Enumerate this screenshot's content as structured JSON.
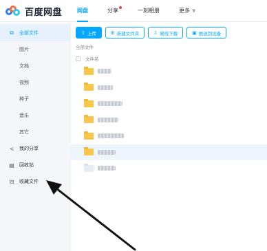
{
  "app": {
    "logo_text": "百度网盘"
  },
  "nav": [
    {
      "label": "网盘",
      "active": true
    },
    {
      "label": "分享",
      "dot": true
    },
    {
      "label": "一刻相册"
    },
    {
      "label": "更多"
    }
  ],
  "sidebar": {
    "items": [
      {
        "label": "全部文件",
        "icon": "files-icon",
        "active": true
      },
      {
        "label": "图片",
        "sub": true
      },
      {
        "label": "文档",
        "sub": true
      },
      {
        "label": "视频",
        "sub": true
      },
      {
        "label": "种子",
        "sub": true
      },
      {
        "label": "音乐",
        "sub": true
      },
      {
        "label": "其它",
        "sub": true
      },
      {
        "label": "我的分享",
        "icon": "share-icon"
      },
      {
        "label": "回收站",
        "icon": "recycle-bin-icon"
      },
      {
        "label": "收藏文件",
        "icon": "favorites-icon"
      }
    ]
  },
  "toolbar": {
    "upload": "上传",
    "new_folder": "新建文件夹",
    "offline_download": "离线下载",
    "save_to_device": "推送到设备"
  },
  "breadcrumb": "全部文件",
  "table": {
    "col_name": "文件名"
  },
  "colors": {
    "accent": "#06a7ff",
    "folder": "#f8c64b"
  }
}
